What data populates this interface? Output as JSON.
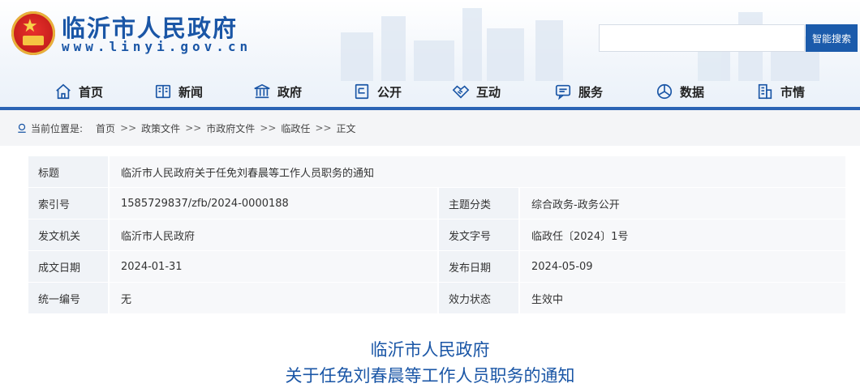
{
  "header": {
    "site_title": "临沂市人民政府",
    "site_url": "www.linyi.gov.cn",
    "search_placeholder": "",
    "search_button": "智能搜索"
  },
  "nav": [
    {
      "label": "首页",
      "icon": "home-icon"
    },
    {
      "label": "新闻",
      "icon": "newspaper-icon"
    },
    {
      "label": "政府",
      "icon": "government-building-icon"
    },
    {
      "label": "公开",
      "icon": "open-document-icon"
    },
    {
      "label": "互动",
      "icon": "handshake-icon"
    },
    {
      "label": "服务",
      "icon": "service-chat-icon"
    },
    {
      "label": "数据",
      "icon": "data-icon"
    },
    {
      "label": "市情",
      "icon": "city-building-icon"
    }
  ],
  "breadcrumb": {
    "prefix": "当前位置是:",
    "items": [
      "首页",
      "政策文件",
      "市政府文件",
      "临政任",
      "正文"
    ],
    "separator": ">>"
  },
  "meta": {
    "title_label": "标题",
    "title_value": "临沂市人民政府关于任免刘春晨等工作人员职务的通知",
    "rows": [
      {
        "label1": "索引号",
        "value1": "1585729837/zfb/2024-0000188",
        "label2": "主题分类",
        "value2": "综合政务-政务公开"
      },
      {
        "label1": "发文机关",
        "value1": "临沂市人民政府",
        "label2": "发文字号",
        "value2": "临政任〔2024〕1号"
      },
      {
        "label1": "成文日期",
        "value1": "2024-01-31",
        "label2": "发布日期",
        "value2": "2024-05-09"
      },
      {
        "label1": "统一编号",
        "value1": "无",
        "label2": "效力状态",
        "value2": "生效中"
      }
    ]
  },
  "document": {
    "title_line1": "临沂市人民政府",
    "title_line2": "关于任免刘春晨等工作人员职务的通知"
  },
  "colors": {
    "brand_blue": "#1a56a6",
    "nav_line": "#2a64b5",
    "search_button": "#1b5bab"
  }
}
